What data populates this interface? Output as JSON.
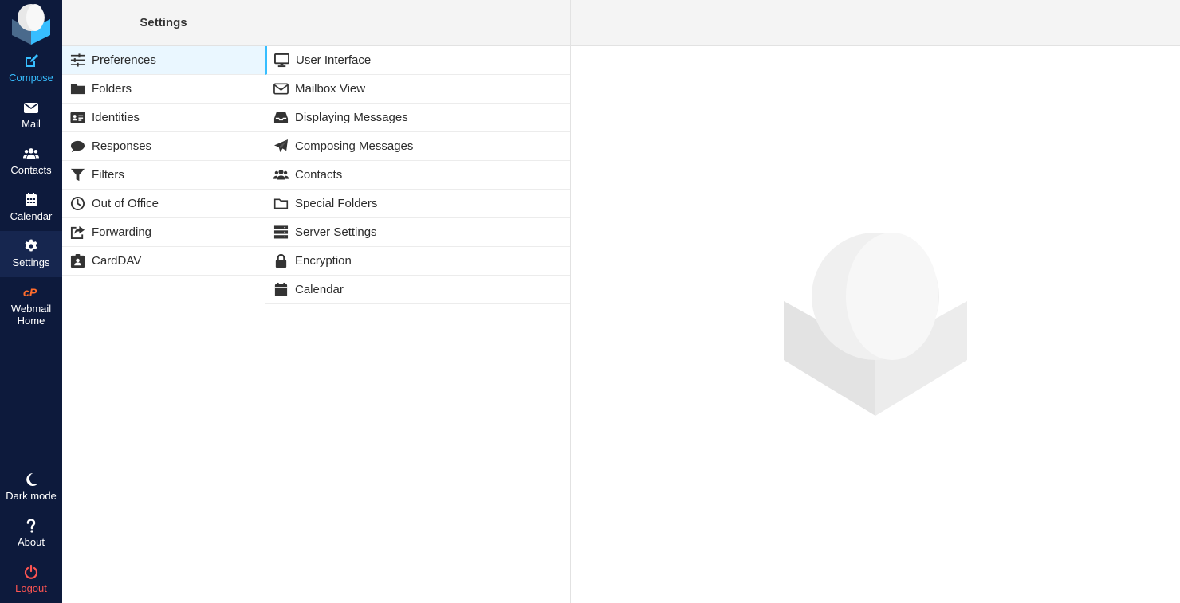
{
  "rail": {
    "items": [
      {
        "label": "Compose",
        "icon": "edit-icon"
      },
      {
        "label": "Mail",
        "icon": "envelope-icon"
      },
      {
        "label": "Contacts",
        "icon": "users-icon"
      },
      {
        "label": "Calendar",
        "icon": "calendar-icon"
      },
      {
        "label": "Settings",
        "icon": "gear-icon"
      },
      {
        "label": "Webmail Home",
        "icon": "cpanel-icon"
      }
    ],
    "bottom": [
      {
        "label": "Dark mode",
        "icon": "moon-icon"
      },
      {
        "label": "About",
        "icon": "question-icon"
      },
      {
        "label": "Logout",
        "icon": "power-icon"
      }
    ],
    "colors": {
      "bg": "#0d1a3c",
      "active": "#16264f",
      "accent": "#37beff",
      "logout": "#ff5552",
      "cpanel": "#ff6c2c"
    }
  },
  "settings": {
    "title": "Settings",
    "sections": [
      {
        "label": "Preferences",
        "icon": "sliders-icon"
      },
      {
        "label": "Folders",
        "icon": "folder-icon"
      },
      {
        "label": "Identities",
        "icon": "id-card-icon"
      },
      {
        "label": "Responses",
        "icon": "comment-icon"
      },
      {
        "label": "Filters",
        "icon": "filter-icon"
      },
      {
        "label": "Out of Office",
        "icon": "clock-icon"
      },
      {
        "label": "Forwarding",
        "icon": "share-icon"
      },
      {
        "label": "CardDAV",
        "icon": "address-book-icon"
      }
    ]
  },
  "preferences": {
    "items": [
      {
        "label": "User Interface",
        "icon": "monitor-icon"
      },
      {
        "label": "Mailbox View",
        "icon": "envelope-outline-icon"
      },
      {
        "label": "Displaying Messages",
        "icon": "inbox-icon"
      },
      {
        "label": "Composing Messages",
        "icon": "paper-plane-icon"
      },
      {
        "label": "Contacts",
        "icon": "users-icon"
      },
      {
        "label": "Special Folders",
        "icon": "folder-outline-icon"
      },
      {
        "label": "Server Settings",
        "icon": "server-icon"
      },
      {
        "label": "Encryption",
        "icon": "lock-icon"
      },
      {
        "label": "Calendar",
        "icon": "calendar-icon"
      }
    ]
  }
}
